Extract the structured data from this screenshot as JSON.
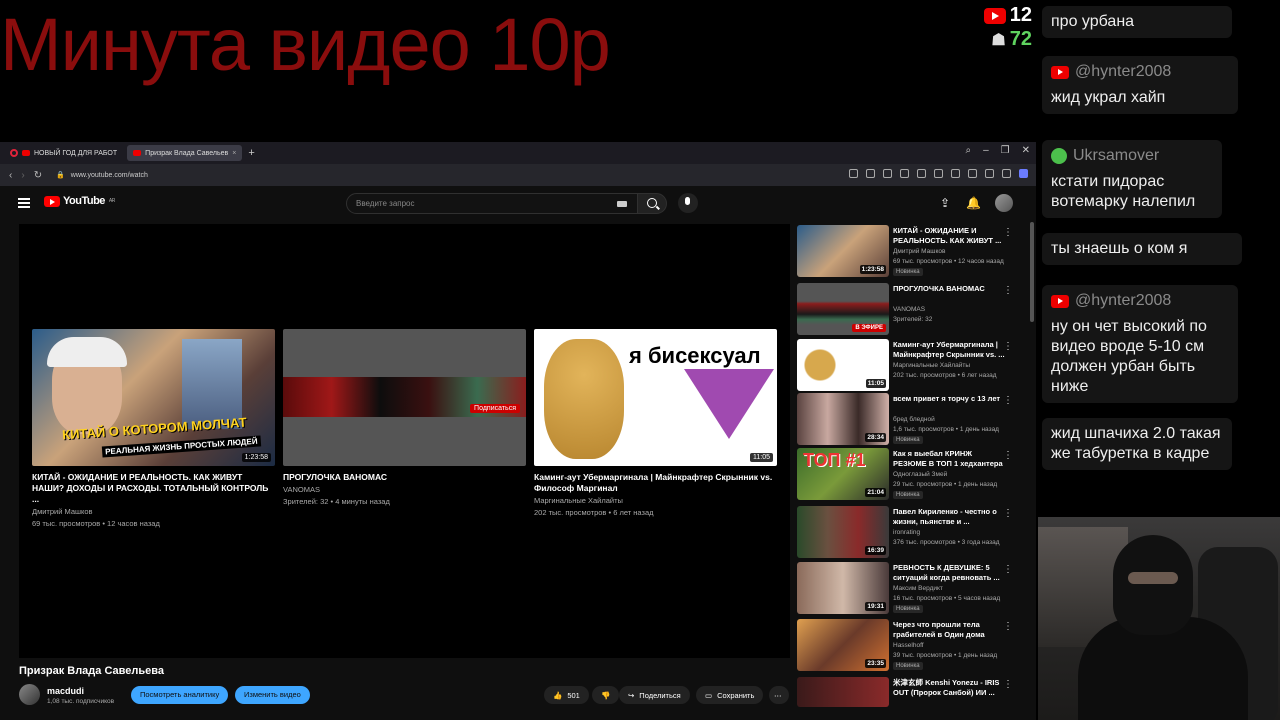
{
  "overlay": {
    "title": "Минута видео 10р",
    "likes_count": "12",
    "viewers_count": "72"
  },
  "chat": [
    {
      "author": "",
      "text": "про урбана"
    },
    {
      "author": "@hynter2008",
      "text": "жид украл хайп"
    },
    {
      "author": "Ukrsamover",
      "text": "кстати пидорас вотемарку налепил"
    },
    {
      "author": "",
      "text": "ты знаешь о ком я"
    },
    {
      "author": "@hynter2008",
      "text": "ну он чет высокий по видео вроде 5-10 см должен урбан быть ниже"
    },
    {
      "author": "",
      "text": "жид шпачиха 2.0 такая же табуретка в кадре"
    }
  ],
  "browser": {
    "tabs": [
      "НОВЫЙ ГОД ДЛЯ РАБОТ",
      "Призрак Влада Савельев"
    ],
    "url": "www.youtube.com/watch"
  },
  "youtube": {
    "logo": "YouTube",
    "logo_region": "AR",
    "search_placeholder": "Введите запрос",
    "endcards": [
      {
        "title": "КИТАЙ - ОЖИДАНИЕ И РЕАЛЬНОСТЬ. КАК ЖИВУТ НАШИ? ДОХОДЫ И РАСХОДЫ. ТОТАЛЬНЫЙ КОНТРОЛЬ ...",
        "channel": "Дмитрий Машков",
        "stats": "69 тыс. просмотров • 12 часов назад",
        "duration": "1:23:58",
        "thumb_text_1": "КИТАЙ О КОТОРОМ МОЛЧАТ",
        "thumb_text_2": "РЕАЛЬНАЯ ЖИЗНЬ ПРОСТЫХ ЛЮДЕЙ"
      },
      {
        "title": "ПРОГУЛОЧКА ВАНОМАС",
        "channel": "VANOMAS",
        "stats": "Зрителей: 32 • 4 минуты назад",
        "subscribe": "Подписаться"
      },
      {
        "title": "Каминг-аут Убермаргинала | Майнкрафтер Скрынник vs. Философ Маргинал",
        "channel": "Маргинальные Хайлайты",
        "stats": "202 тыс. просмотров • 6 лет назад",
        "duration": "11:05",
        "thumb_text": "я бисексуал"
      }
    ],
    "video_title": "Призрак Влада Савельева",
    "channel_name": "macdudi",
    "channel_subs": "1,08 тыс. подписчиков",
    "btn_analytics": "Посмотреть аналитику",
    "btn_edit": "Изменить видео",
    "likes": "501",
    "share": "Поделиться",
    "save": "Сохранить",
    "related": [
      {
        "title": "КИТАЙ - ОЖИДАНИЕ И РЕАЛЬНОСТЬ. КАК ЖИВУТ ...",
        "channel": "Дмитрий Машков",
        "stats": "69 тыс. просмотров • 12 часов назад",
        "badge": "Новинка",
        "duration": "1:23:58"
      },
      {
        "title": "ПРОГУЛОЧКА ВАНОМАС",
        "channel": "VANOMAS",
        "stats": "Зрителей: 32",
        "badge": "",
        "duration": "В ЭФИРЕ"
      },
      {
        "title": "Каминг-аут Убермаргинала | Майнкрафтер Скрынник vs. ...",
        "channel": "Маргинальные Хайлайты",
        "stats": "202 тыс. просмотров • 6 лет назад",
        "badge": "",
        "duration": "11:05"
      },
      {
        "title": "всем привет я торчу с 13 лет",
        "channel": "бред бледной",
        "stats": "1,6 тыс. просмотров • 1 день назад",
        "badge": "Новинка",
        "duration": "28:34"
      },
      {
        "title": "Как я выебал КРИНЖ РЕЗЮМЕ В ТОП 1 хедхантера",
        "channel": "Одноглазый Змей",
        "stats": "29 тыс. просмотров • 1 день назад",
        "badge": "Новинка",
        "duration": "21:04"
      },
      {
        "title": "Павел Кириленко - честно о жизни, пьянстве и ...",
        "channel": "ironrating",
        "stats": "376 тыс. просмотров • 3 года назад",
        "badge": "",
        "duration": "16:39"
      },
      {
        "title": "РЕВНОСТЬ К ДЕВУШКЕ: 5 ситуаций когда ревновать ...",
        "channel": "Максим Вердикт",
        "stats": "16 тыс. просмотров • 5 часов назад",
        "badge": "Новинка",
        "duration": "19:31"
      },
      {
        "title": "Через что прошли тела грабителей в Один дома",
        "channel": "Hasselhoff",
        "stats": "39 тыс. просмотров • 1 день назад",
        "badge": "Новинка",
        "duration": "23:35"
      },
      {
        "title": "米津玄師 Kenshi Yonezu - IRIS OUT (Пророк Санбой) ИИ ...",
        "channel": "",
        "stats": "",
        "badge": "",
        "duration": ""
      }
    ]
  }
}
